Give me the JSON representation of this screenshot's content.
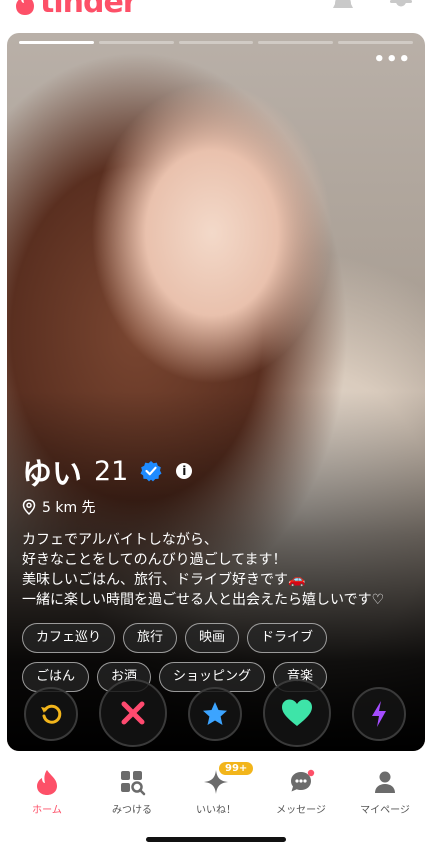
{
  "header": {
    "logo_text": "tinder",
    "brand_color": "#fd5068",
    "icons": [
      "bell-icon",
      "filter-icon"
    ]
  },
  "card": {
    "photo_count": 5,
    "active_photo": 1,
    "name": "ゆい",
    "age": "21",
    "verified": true,
    "distance": "5 km 先",
    "bio": "カフェでアルバイトしながら、\n好きなことをしてのんびり過ごしてます！\n美味しいごはん、旅行、ドライブ好きです🚗\n一緒に楽しい時間を過ごせる人と出会えたら嬉しいです♡",
    "tags": [
      "カフェ巡り",
      "旅行",
      "映画",
      "ドライブ",
      "ごはん",
      "お酒",
      "ショッピング",
      "音楽"
    ]
  },
  "actions": [
    {
      "name": "rewind",
      "color": "#f2b51b"
    },
    {
      "name": "nope",
      "color": "#ff4a6f"
    },
    {
      "name": "super-like",
      "color": "#3ca4ff"
    },
    {
      "name": "like",
      "color": "#3ee4a8"
    },
    {
      "name": "boost",
      "color": "#a54cff"
    }
  ],
  "tabbar": {
    "items": [
      {
        "label": "ホーム",
        "icon": "flame-icon",
        "active": true
      },
      {
        "label": "みつける",
        "icon": "explore-icon",
        "active": false
      },
      {
        "label": "いいね！",
        "icon": "sparkle-icon",
        "active": false,
        "badge": "99+"
      },
      {
        "label": "メッセージ",
        "icon": "chat-icon",
        "active": false
      },
      {
        "label": "マイページ",
        "icon": "profile-icon",
        "active": false
      }
    ]
  }
}
